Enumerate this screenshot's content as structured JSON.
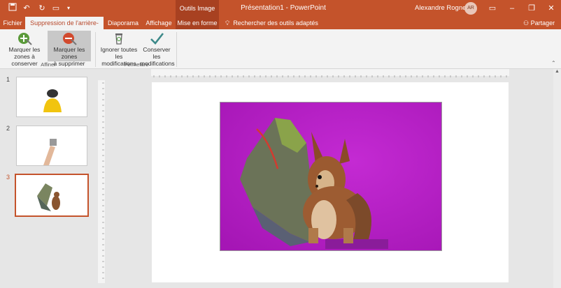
{
  "title_bar": {
    "document_title": "Présentation1  -  PowerPoint",
    "context_group": "Outils Image",
    "user_name": "Alexandre Rogner",
    "user_initials": "AR",
    "quick_access": [
      "save-icon",
      "undo-icon",
      "redo-icon",
      "present-icon",
      "customize-icon"
    ],
    "window_buttons": [
      "ribbon-display-icon",
      "minimize-icon",
      "restore-icon",
      "close-icon"
    ]
  },
  "tabs": {
    "file": "Fichier",
    "background_removal": "Suppression de l'arrière-plan",
    "slideshow": "Diaporama",
    "view": "Affichage",
    "format": "Mise en forme",
    "search": "Rechercher des outils adaptés",
    "share": "Partager"
  },
  "ribbon": {
    "refine_group": {
      "label": "Affiner",
      "mark_keep_line1": "Marquer les",
      "mark_keep_line2": "zones à conserver",
      "mark_remove_line1": "Marquer les zones",
      "mark_remove_line2": "à supprimer"
    },
    "close_group": {
      "label": "Fermeture",
      "discard_line1": "Ignorer toutes",
      "discard_line2": "les modifications",
      "keep_line1": "Conserver les",
      "keep_line2": "modifications"
    }
  },
  "slides": [
    {
      "number": "1"
    },
    {
      "number": "2"
    },
    {
      "number": "3",
      "selected": true
    }
  ],
  "colors": {
    "accent": "#c4532b",
    "removal_overlay": "#b51fc2"
  }
}
